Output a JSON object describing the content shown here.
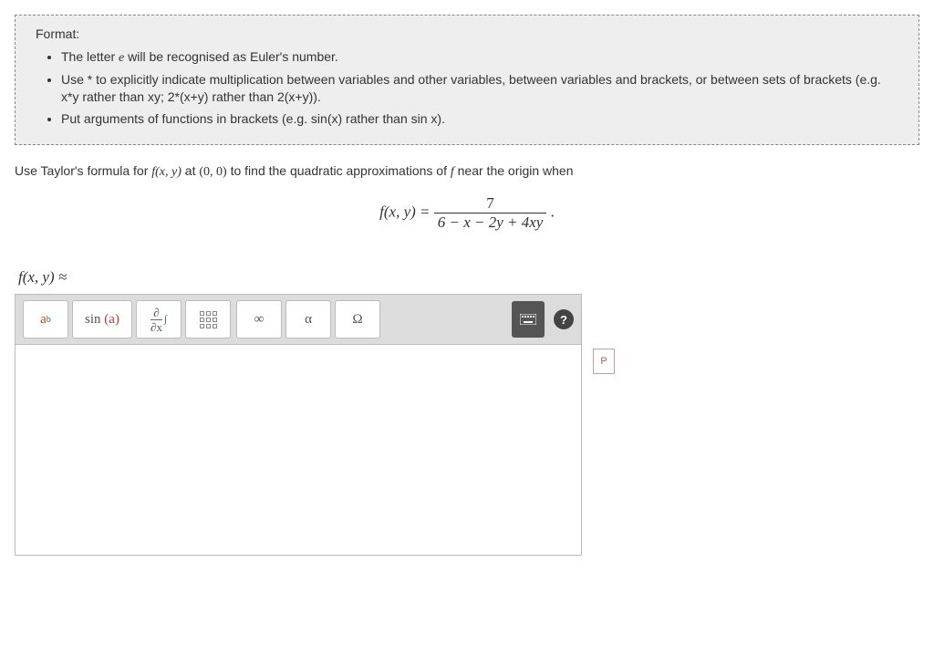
{
  "format": {
    "title": "Format:",
    "items": [
      "The letter e will be recognised as Euler's number.",
      "Use * to explicitly indicate multiplication between variables and other variables, between variables and brackets, or between sets of brackets (e.g. x*y rather than xy; 2*(x+y) rather than 2(x+y)).",
      "Put arguments of functions in brackets (e.g. sin(x) rather than sin x)."
    ]
  },
  "problem": {
    "prefix": "Use Taylor's formula for ",
    "fxy": "f(x, y)",
    "at": " at ",
    "point": "(0, 0)",
    "mid": " to find the quadratic approximations of ",
    "f": "f",
    "suffix": " near the origin when"
  },
  "equation": {
    "lhs": "f(x, y) = ",
    "numerator": "7",
    "denominator": "6 − x − 2y + 4xy",
    "trail": "."
  },
  "answer_label": "f(x, y) ≈",
  "toolbar": {
    "power": "a",
    "power_sup": "b",
    "sin": "sin",
    "sin_arg": "(a)",
    "partial_top": "∂",
    "partial_bot": "∂x",
    "int": "∫",
    "infinity": "∞",
    "alpha": "α",
    "omega": "Ω",
    "help": "?"
  },
  "preview": "P"
}
